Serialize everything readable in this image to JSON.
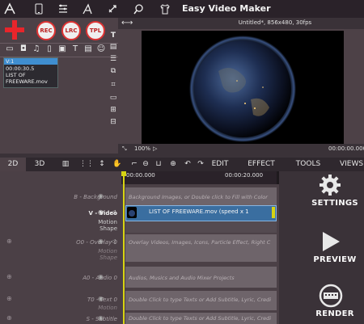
{
  "app": {
    "title": "Easy Video Maker"
  },
  "toolbar_icons": [
    "app-logo-icon",
    "phone-icon",
    "menu-icon",
    "tools-icon",
    "rocket-icon",
    "search-icon",
    "shirt-icon"
  ],
  "media": {
    "buttons": [
      "REC",
      "LRC",
      "TPL"
    ],
    "clip": {
      "name": "V:1",
      "duration": "00:00:30.5",
      "title_line1": "LIST OF",
      "title_line2": "FREEWARE.mov"
    }
  },
  "preview": {
    "info": "Untitled*, 856x480, 30fps",
    "zoom": "100%",
    "timecode": "00:00:00.000"
  },
  "tabs": {
    "t2d": "2D",
    "t3d": "3D",
    "edit": "EDIT",
    "effect": "EFFECT",
    "tools": "TOOLS",
    "views": "VIEWS"
  },
  "timeline": {
    "ruler": [
      "00:00.000",
      "00:00:20.000"
    ],
    "tracks": [
      {
        "label": "B - Background",
        "content": "Background Images, or Double click to Fill with Color"
      },
      {
        "label": "V - Video",
        "sub1": "Motion",
        "sub2": "Shape",
        "clip": "LIST OF FREEWARE.mov  (speed x 1"
      },
      {
        "label": "O0 - Overlay 0",
        "sub1": "Motion",
        "sub2": "Shape",
        "content": "Overlay Videos, Images, Icons, Particle Effect, Right C"
      },
      {
        "label": "A0 - Audio 0",
        "content": "Audios, Musics and Audio Mixer Projects"
      },
      {
        "label": "T0 - Text 0",
        "sub1": "Motion",
        "content": "Double Click to type Texts or Add Subtitle, Lyric, Credi"
      },
      {
        "label": "S - Subtitle",
        "content": "Double Click to type Texts or Add Subtitle, Lyric, Credi"
      }
    ]
  },
  "actions": {
    "settings": "SETTINGS",
    "preview": "PREVIEW",
    "render": "RENDER"
  },
  "colors": {
    "accent_red": "#e8252b",
    "playhead": "#d7d312",
    "selection": "#3f8ed0"
  }
}
